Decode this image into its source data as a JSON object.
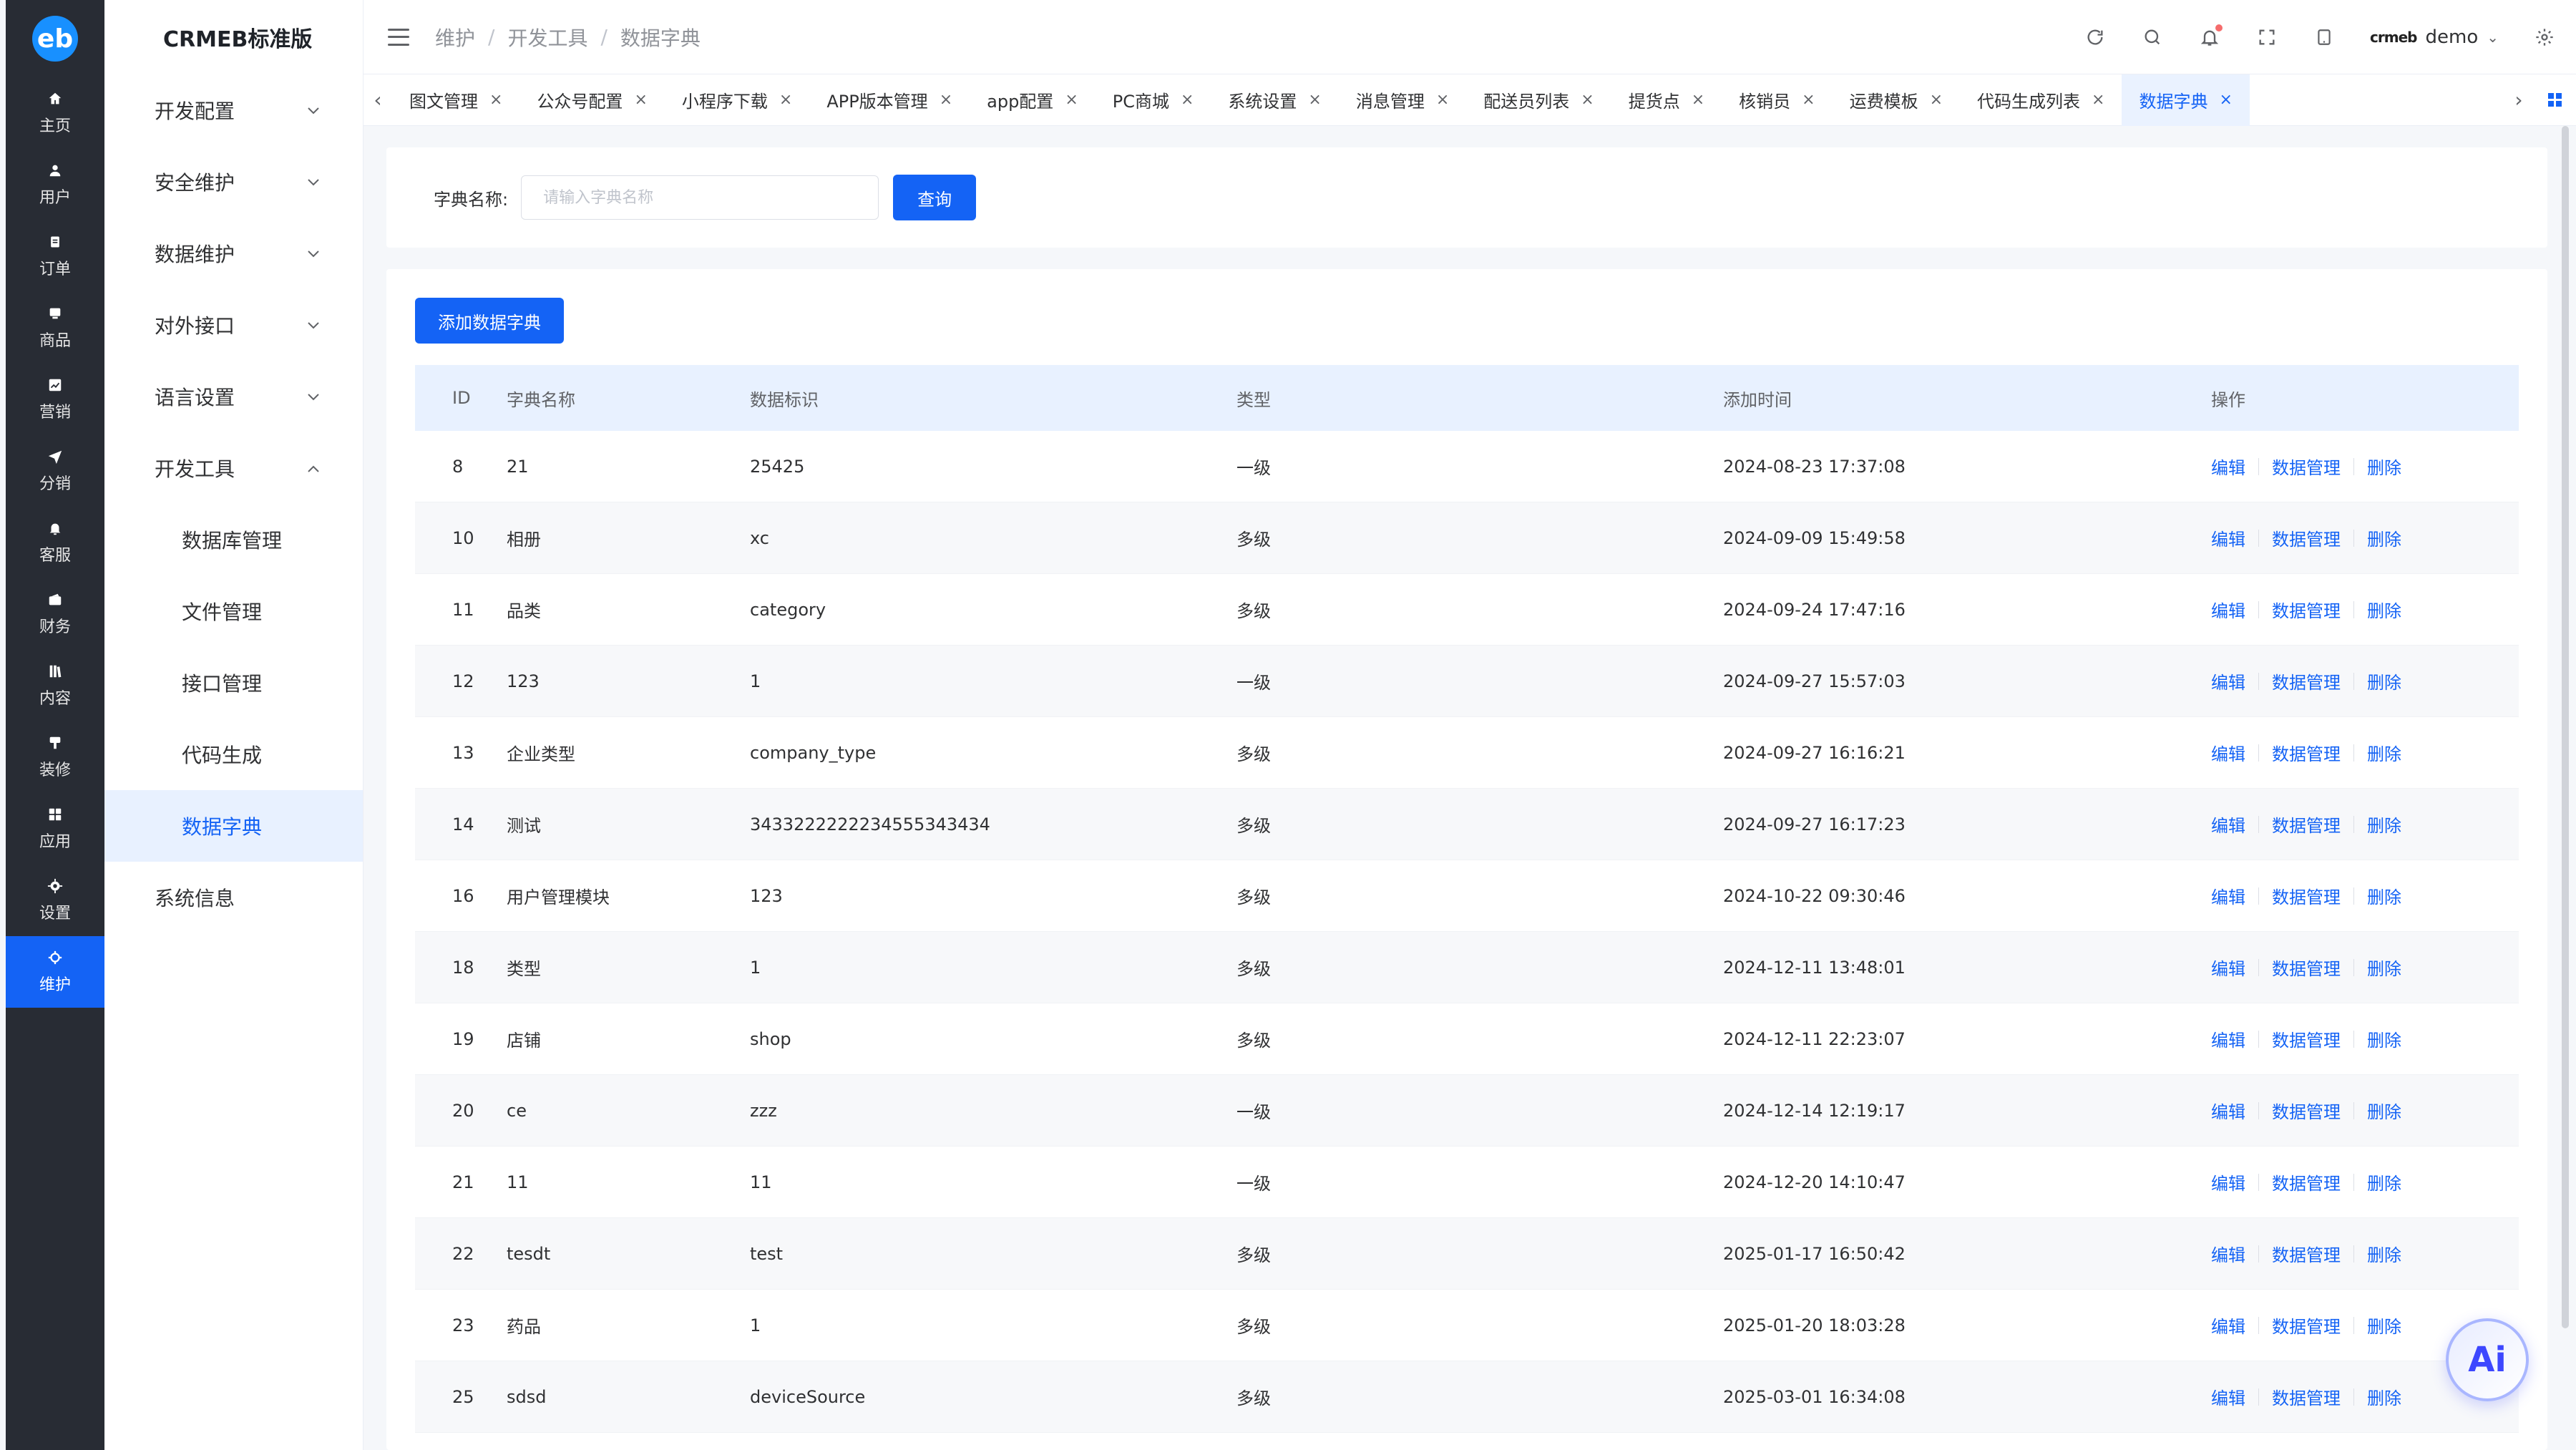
{
  "rail": {
    "logo_text": "eb",
    "items": [
      {
        "label": "主页",
        "icon": "home-icon"
      },
      {
        "label": "用户",
        "icon": "user-icon"
      },
      {
        "label": "订单",
        "icon": "clipboard-icon"
      },
      {
        "label": "商品",
        "icon": "box-icon"
      },
      {
        "label": "营销",
        "icon": "chart-icon"
      },
      {
        "label": "分销",
        "icon": "paper-plane-icon"
      },
      {
        "label": "客服",
        "icon": "bell-icon"
      },
      {
        "label": "财务",
        "icon": "wallet-icon"
      },
      {
        "label": "内容",
        "icon": "book-icon"
      },
      {
        "label": "装修",
        "icon": "brush-icon"
      },
      {
        "label": "应用",
        "icon": "apps-icon"
      },
      {
        "label": "设置",
        "icon": "gear-icon"
      },
      {
        "label": "维护",
        "icon": "maintenance-icon",
        "active": true
      }
    ]
  },
  "subnav": {
    "brand": "CRMEB标准版",
    "groups": [
      {
        "label": "开发配置",
        "expanded": false
      },
      {
        "label": "安全维护",
        "expanded": false
      },
      {
        "label": "数据维护",
        "expanded": false
      },
      {
        "label": "对外接口",
        "expanded": false
      },
      {
        "label": "语言设置",
        "expanded": false
      },
      {
        "label": "开发工具",
        "expanded": true
      }
    ],
    "dev_tools_children": [
      "数据库管理",
      "文件管理",
      "接口管理",
      "代码生成",
      "数据字典"
    ],
    "last_item": "系统信息"
  },
  "header": {
    "breadcrumb": [
      "维护",
      "开发工具",
      "数据字典"
    ],
    "user_brand": "crmeb",
    "user_name": "demo"
  },
  "tabs": [
    {
      "label": "图文管理"
    },
    {
      "label": "公众号配置"
    },
    {
      "label": "小程序下载"
    },
    {
      "label": "APP版本管理"
    },
    {
      "label": "app配置"
    },
    {
      "label": "PC商城"
    },
    {
      "label": "系统设置"
    },
    {
      "label": "消息管理"
    },
    {
      "label": "配送员列表"
    },
    {
      "label": "提货点"
    },
    {
      "label": "核销员"
    },
    {
      "label": "运费模板"
    },
    {
      "label": "代码生成列表"
    },
    {
      "label": "数据字典",
      "active": true
    }
  ],
  "search": {
    "label": "字典名称:",
    "placeholder": "请输入字典名称",
    "button": "查询"
  },
  "add_button": "添加数据字典",
  "table": {
    "headers": [
      "ID",
      "字典名称",
      "数据标识",
      "类型",
      "添加时间",
      "操作"
    ],
    "ops": [
      "编辑",
      "数据管理",
      "删除"
    ],
    "rows": [
      {
        "id": "8",
        "name": "21",
        "key": "25425",
        "type": "一级",
        "time": "2024-08-23 17:37:08"
      },
      {
        "id": "10",
        "name": "相册",
        "key": "xc",
        "type": "多级",
        "time": "2024-09-09 15:49:58"
      },
      {
        "id": "11",
        "name": "品类",
        "key": "category",
        "type": "多级",
        "time": "2024-09-24 17:47:16"
      },
      {
        "id": "12",
        "name": "123",
        "key": "1",
        "type": "一级",
        "time": "2024-09-27 15:57:03"
      },
      {
        "id": "13",
        "name": "企业类型",
        "key": "company_type",
        "type": "多级",
        "time": "2024-09-27 16:16:21"
      },
      {
        "id": "14",
        "name": "测试",
        "key": "3433222222234555343434",
        "type": "多级",
        "time": "2024-09-27 16:17:23"
      },
      {
        "id": "16",
        "name": "用户管理模块",
        "key": "123",
        "type": "多级",
        "time": "2024-10-22 09:30:46"
      },
      {
        "id": "18",
        "name": "类型",
        "key": "1",
        "type": "多级",
        "time": "2024-12-11 13:48:01"
      },
      {
        "id": "19",
        "name": "店铺",
        "key": "shop",
        "type": "多级",
        "time": "2024-12-11 22:23:07"
      },
      {
        "id": "20",
        "name": "ce",
        "key": "zzz",
        "type": "一级",
        "time": "2024-12-14 12:19:17"
      },
      {
        "id": "21",
        "name": "11",
        "key": "11",
        "type": "一级",
        "time": "2024-12-20 14:10:47"
      },
      {
        "id": "22",
        "name": "tesdt",
        "key": "test",
        "type": "多级",
        "time": "2025-01-17 16:50:42"
      },
      {
        "id": "23",
        "name": "药品",
        "key": "1",
        "type": "多级",
        "time": "2025-01-20 18:03:28"
      },
      {
        "id": "25",
        "name": "sdsd",
        "key": "deviceSource",
        "type": "多级",
        "time": "2025-03-01 16:34:08"
      }
    ]
  },
  "ai_button": "Ai",
  "colors": {
    "primary": "#1463f5",
    "rail_bg": "#282c34",
    "header_row_bg": "#e8f1ff"
  }
}
